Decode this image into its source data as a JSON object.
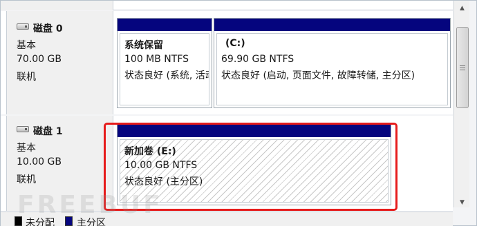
{
  "disks": [
    {
      "name": "磁盘 0",
      "type": "基本",
      "size": "70.00 GB",
      "status": "联机",
      "partitions": [
        {
          "name": "系统保留",
          "size_fs": "100 MB NTFS",
          "status": "状态良好 (系统, 活动, 主分区)"
        },
        {
          "name": "(C:)",
          "size_fs": "69.90 GB NTFS",
          "status": "状态良好 (启动, 页面文件, 故障转储, 主分区)"
        }
      ]
    },
    {
      "name": "磁盘 1",
      "type": "基本",
      "size": "10.00 GB",
      "status": "联机",
      "partitions": [
        {
          "name": "新加卷  (E:)",
          "size_fs": "10.00 GB NTFS",
          "status": "状态良好 (主分区)"
        }
      ]
    }
  ],
  "legend": {
    "unallocated": {
      "label": "未分配",
      "color": "#000000"
    },
    "primary": {
      "label": "主分区",
      "color": "#05057e"
    }
  },
  "watermark": "FREEBUF",
  "colors": {
    "partition_bar": "#05057e",
    "highlight": "#e61b1b"
  }
}
